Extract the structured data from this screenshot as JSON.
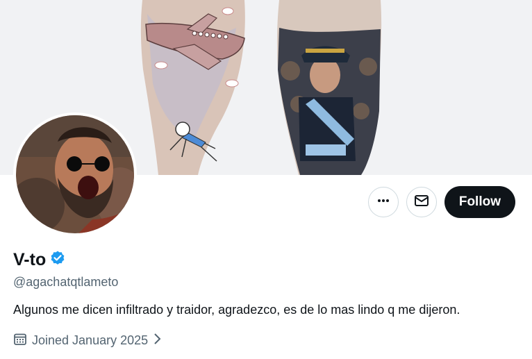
{
  "profile": {
    "display_name": "V-to",
    "handle": "@agachatqtlameto",
    "bio": "Algunos me dicen infiltrado y traidor, agradezco, es de lo mas lindo q me dijeron.",
    "joined": "Joined January 2025",
    "verified": true
  },
  "actions": {
    "follow_label": "Follow",
    "more_icon": "more-horizontal-icon",
    "message_icon": "envelope-icon"
  },
  "colors": {
    "follow_bg": "#0f1419",
    "verified_badge": "#1d9bf0",
    "secondary_text": "#536471",
    "border": "#cfd9de"
  }
}
